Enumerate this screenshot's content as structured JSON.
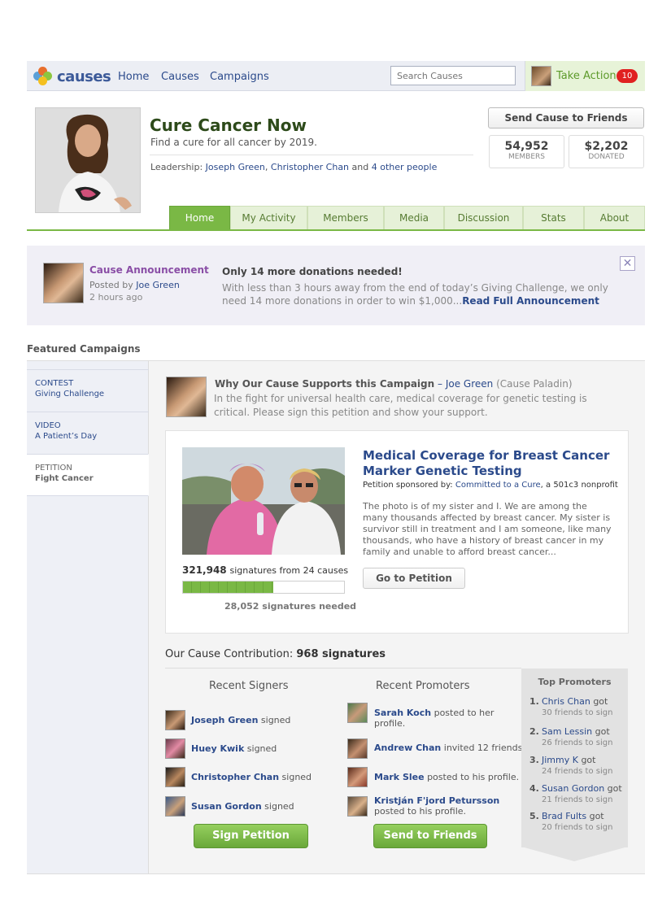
{
  "nav": {
    "brand": "causes",
    "links": [
      "Home",
      "Causes",
      "Campaigns"
    ],
    "search_placeholder": "Search Causes",
    "take_action": "Take Action",
    "take_action_count": "10"
  },
  "cause": {
    "title": "Cure Cancer Now",
    "tagline": "Find a cure for all cancer by 2019.",
    "leadership_label": "Leadership:",
    "leader1": "Joseph Green",
    "leader2": "Christopher Chan",
    "leadership_and": "and",
    "leadership_others": "4 other people",
    "send_button": "Send Cause to Friends",
    "members_count": "54,952",
    "members_label": "MEMBERS",
    "donated_amount": "$2,202",
    "donated_label": "DONATED"
  },
  "tabs": [
    "Home",
    "My Activity",
    "Members",
    "Media",
    "Discussion",
    "Stats",
    "About"
  ],
  "announcement": {
    "title": "Cause Announcement",
    "posted_by_label": "Posted by",
    "posted_by": "Joe Green",
    "time": "2 hours ago",
    "headline": "Only 14 more donations needed!",
    "body": "With less than 3 hours away from the end of today’s Giving Challenge, we only need 14 more donations in order to win $1,000...",
    "read_more": "Read Full Announcement"
  },
  "featured_label": "Featured Campaigns",
  "sidebar": [
    {
      "kind": "CONTEST",
      "name": "Giving Challenge"
    },
    {
      "kind": "VIDEO",
      "name": "A Patient’s Day"
    },
    {
      "kind": "PETITION",
      "name": "Fight Cancer"
    }
  ],
  "campaign": {
    "why_title": "Why Our Cause Supports this Campaign",
    "why_sep": "–",
    "why_author": "Joe Green",
    "why_role": "(Cause Paladin)",
    "why_body": "In the fight for universal health care, medical coverage for genetic testing is critical. Please sign this petition and show your support.",
    "petition_title": "Medical Coverage for Breast Cancer Marker Genetic Testing",
    "sponsor_label": "Petition sponsored by:",
    "sponsor": "Committed to a Cure",
    "sponsor_suffix": ", a 501c3 nonprofit",
    "description": "The photo is of my sister and I. We are among the many thousands affected by breast cancer. My sister is survivor still in treatment and I am someone, like many thousands, who have a history of breast cancer in my family and unable to afford breast cancer...",
    "signatures": "321,948",
    "signatures_suffix": "signatures from 24 causes",
    "progress": 0.56,
    "signatures_needed": "28,052 signatures needed",
    "go_button": "Go to Petition",
    "contribution_label": "Our Cause Contribution:",
    "contribution_value": "968 signatures"
  },
  "recent_signers": {
    "title": "Recent Signers",
    "items": [
      {
        "name": "Joseph Green",
        "action": "signed"
      },
      {
        "name": "Huey Kwik",
        "action": "signed"
      },
      {
        "name": "Christopher Chan",
        "action": "signed"
      },
      {
        "name": "Susan Gordon",
        "action": "signed"
      }
    ],
    "button": "Sign Petition"
  },
  "recent_promoters": {
    "title": "Recent Promoters",
    "items": [
      {
        "name": "Sarah Koch",
        "action": "posted to her profile."
      },
      {
        "name": "Andrew Chan",
        "action": "invited 12 friends."
      },
      {
        "name": "Mark Slee",
        "action": "posted to his profile."
      },
      {
        "name": "Kristján F'jord Petursson",
        "action": "posted to his profile."
      }
    ],
    "button": "Send to Friends"
  },
  "top_promoters": {
    "title": "Top Promoters",
    "items": [
      {
        "idx": "1.",
        "name": "Chris Chan",
        "verb": "got",
        "sub": "30 friends to sign"
      },
      {
        "idx": "2.",
        "name": "Sam Lessin",
        "verb": "got",
        "sub": "26 friends to sign"
      },
      {
        "idx": "3.",
        "name": "Jimmy K",
        "verb": "got",
        "sub": "24 friends to sign"
      },
      {
        "idx": "4.",
        "name": "Susan Gordon",
        "verb": "got",
        "sub": "21 friends to sign"
      },
      {
        "idx": "5.",
        "name": "Brad Fults",
        "verb": "got",
        "sub": "20 friends to sign"
      }
    ]
  },
  "colors": {
    "accent_green": "#7ab845",
    "link_blue": "#2b4a8b",
    "badge_red": "#e02020",
    "announce_purple": "#8a4ea6"
  }
}
